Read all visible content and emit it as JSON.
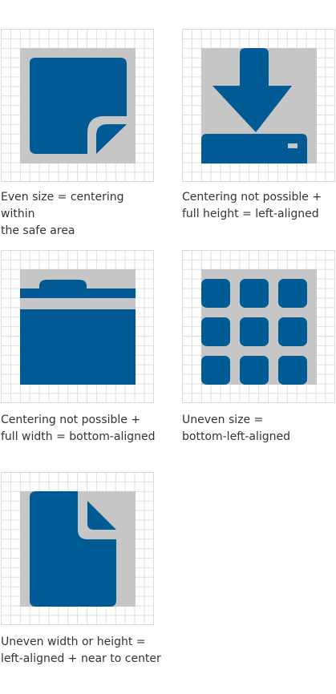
{
  "examples": [
    {
      "caption_line1": "Even size = centering within",
      "caption_line2": "the safe area",
      "icon": "document-folded-corner-icon"
    },
    {
      "caption_line1": "Centering not possible +",
      "caption_line2": "full height = left-aligned",
      "icon": "download-icon"
    },
    {
      "caption_line1": "Centering not possible +",
      "caption_line2": "full width = bottom-aligned",
      "icon": "folder-icon"
    },
    {
      "caption_line1": "Uneven size =",
      "caption_line2": "bottom-left-aligned",
      "icon": "grid-menu-icon"
    },
    {
      "caption_line1": "Uneven width or height =",
      "caption_line2": "left-aligned + near to center",
      "icon": "file-icon"
    }
  ],
  "colors": {
    "icon": "#005a94",
    "safe_area": "#c6c6c6",
    "grid": "#dedede"
  }
}
